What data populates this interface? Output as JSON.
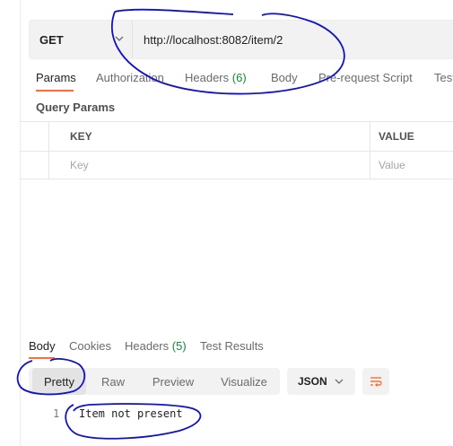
{
  "request": {
    "method": "GET",
    "url": "http://localhost:8082/item/2"
  },
  "request_tabs": [
    {
      "label": "Params",
      "active": true
    },
    {
      "label": "Authorization"
    },
    {
      "label": "Headers",
      "count": "(6)"
    },
    {
      "label": "Body"
    },
    {
      "label": "Pre-request Script"
    },
    {
      "label": "Test"
    }
  ],
  "query_params": {
    "title": "Query Params",
    "columns": [
      "KEY",
      "VALUE"
    ],
    "placeholder_row": [
      "Key",
      "Value"
    ]
  },
  "response_tabs": [
    {
      "label": "Body",
      "active": true
    },
    {
      "label": "Cookies"
    },
    {
      "label": "Headers",
      "count": "(5)"
    },
    {
      "label": "Test Results"
    }
  ],
  "response_view": {
    "modes": [
      "Pretty",
      "Raw",
      "Preview",
      "Visualize"
    ],
    "selected_mode": "Pretty",
    "format": "JSON"
  },
  "response_body": {
    "lines": [
      {
        "number": "1",
        "text": "Item not present"
      }
    ]
  },
  "colors": {
    "accent": "#ff6c37",
    "count_green": "#0f8c3c",
    "annotation_ink": "#1010c8"
  },
  "icons": [
    "chevron-down-icon",
    "wrap-lines-icon"
  ]
}
